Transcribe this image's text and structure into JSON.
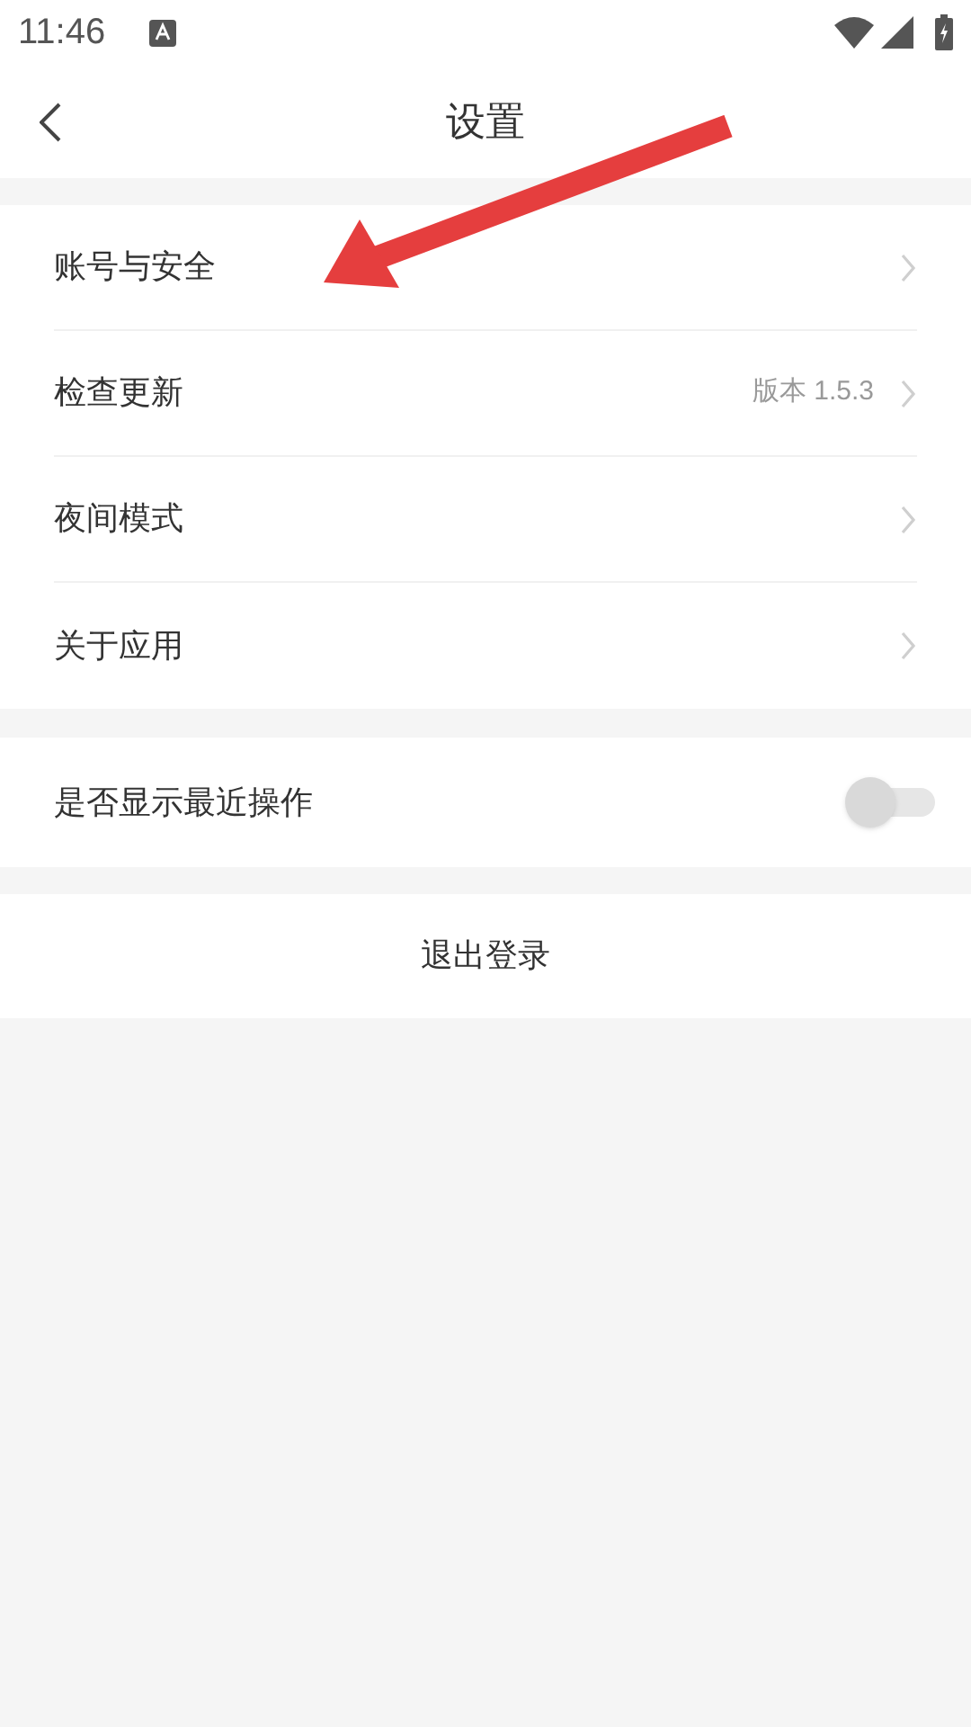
{
  "status_bar": {
    "time": "11:46"
  },
  "header": {
    "title": "设置"
  },
  "menu": [
    {
      "label": "账号与安全"
    },
    {
      "label": "检查更新",
      "value": "版本 1.5.3"
    },
    {
      "label": "夜间模式"
    },
    {
      "label": "关于应用"
    }
  ],
  "toggle_row": {
    "label": "是否显示最近操作",
    "on": false
  },
  "logout_button": {
    "label": "退出登录"
  }
}
